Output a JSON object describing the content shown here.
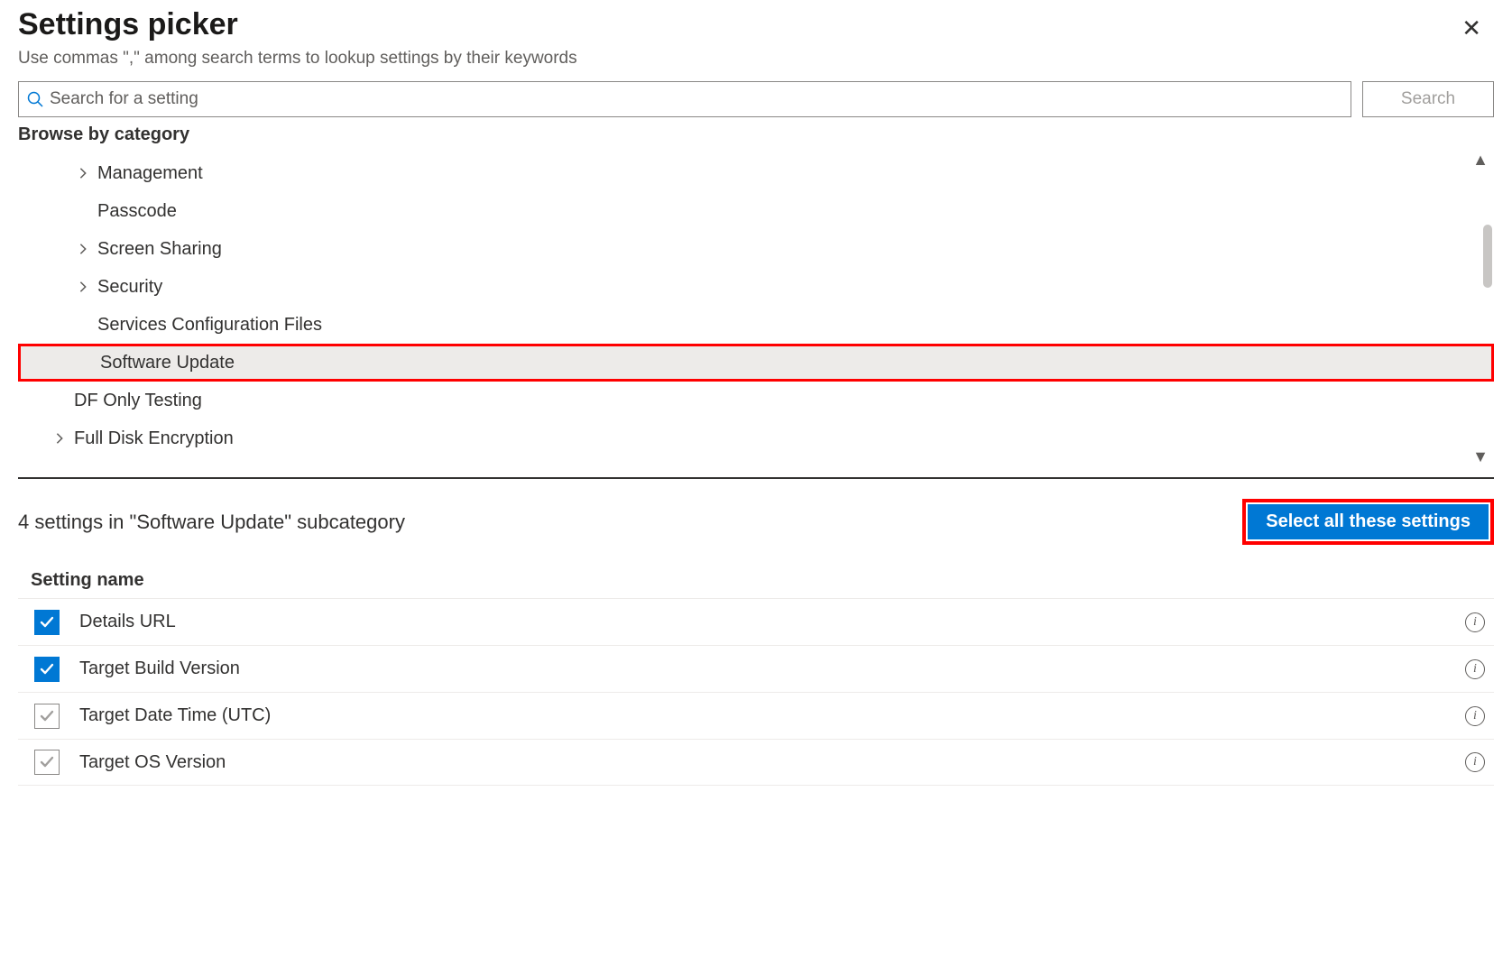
{
  "header": {
    "title": "Settings picker",
    "subtitle": "Use commas \",\" among search terms to lookup settings by their keywords"
  },
  "search": {
    "placeholder": "Search for a setting",
    "button_label": "Search"
  },
  "browse_label": "Browse by category",
  "tree": [
    {
      "label": "Management",
      "has_children": true,
      "indent": true
    },
    {
      "label": "Passcode",
      "has_children": false,
      "indent": true
    },
    {
      "label": "Screen Sharing",
      "has_children": true,
      "indent": true
    },
    {
      "label": "Security",
      "has_children": true,
      "indent": true
    },
    {
      "label": "Services Configuration Files",
      "has_children": false,
      "indent": true
    },
    {
      "label": "Software Update",
      "has_children": false,
      "indent": true,
      "selected": true,
      "highlighted": true
    },
    {
      "label": "DF Only Testing",
      "has_children": false,
      "indent": false
    },
    {
      "label": "Full Disk Encryption",
      "has_children": true,
      "indent": false
    }
  ],
  "subcategory": {
    "count_text": "4 settings in \"Software Update\" subcategory",
    "select_all_label": "Select all these settings",
    "column_header": "Setting name"
  },
  "settings": [
    {
      "name": "Details URL",
      "checked": true
    },
    {
      "name": "Target Build Version",
      "checked": true
    },
    {
      "name": "Target Date Time (UTC)",
      "checked": false
    },
    {
      "name": "Target OS Version",
      "checked": false
    }
  ],
  "info_glyph": "i"
}
